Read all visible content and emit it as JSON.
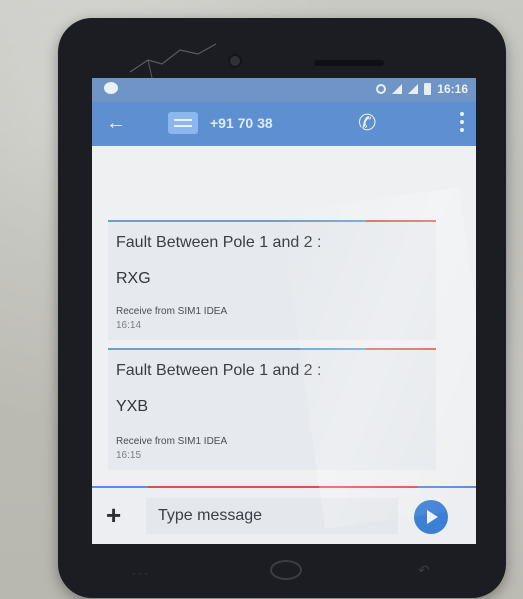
{
  "status_bar": {
    "time": "16:16"
  },
  "app_bar": {
    "contact": "+91 70 38 ",
    "back_icon": "arrow-left-icon",
    "call_icon": "phone-icon",
    "menu_icon": "more-vertical-icon"
  },
  "messages": [
    {
      "title": "Fault Between Pole 1 and 2 :",
      "code": "RXG",
      "from": "Receive from SIM1 IDEA",
      "time": "16:14"
    },
    {
      "title": "Fault Between Pole 1 and 2 :",
      "code": "YXB",
      "from": "Receive from SIM1 IDEA",
      "time": "16:15"
    }
  ],
  "compose": {
    "placeholder": "Type message",
    "add_icon": "plus-icon",
    "send_icon": "send-icon"
  },
  "colors": {
    "app_bar": "#5e8fd0",
    "status_bar": "#6f95c7",
    "send_button": "#3e7fd6"
  }
}
